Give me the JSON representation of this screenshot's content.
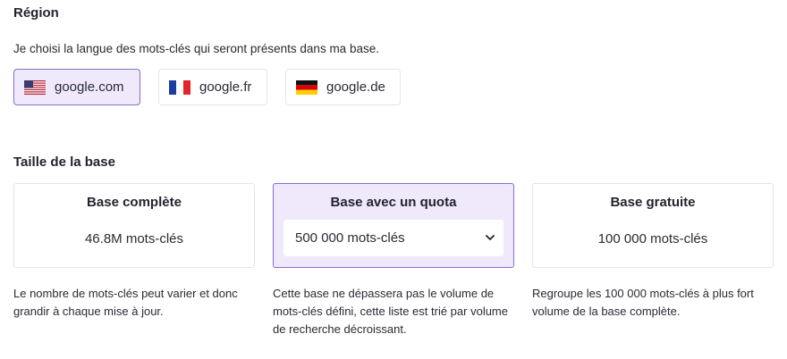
{
  "region": {
    "title": "Région",
    "description": "Je choisi la langue des mots-clés qui seront présents dans ma base.",
    "options": [
      {
        "label": "google.com",
        "flag": "us-flag-icon",
        "selected": true
      },
      {
        "label": "google.fr",
        "flag": "fr-flag-icon",
        "selected": false
      },
      {
        "label": "google.de",
        "flag": "de-flag-icon",
        "selected": false
      }
    ]
  },
  "base_size": {
    "title": "Taille de la base",
    "cards": [
      {
        "title": "Base complète",
        "value": "46.8M mots-clés",
        "description": "Le nombre de mots-clés peut varier et donc grandir à chaque mise à jour.",
        "selected": false
      },
      {
        "title": "Base avec un quota",
        "select_value": "500 000 mots-clés",
        "description": "Cette base ne dépassera pas le volume de mots-clés défini, cette liste est trié par volume de recherche décroissant.",
        "selected": true
      },
      {
        "title": "Base gratuite",
        "value": "100 000 mots-clés",
        "description": "Regroupe les 100 000 mots-clés à plus fort volume de la base complète.",
        "selected": false
      }
    ]
  },
  "colors": {
    "accent_bg": "#efe9fb",
    "accent_border": "#8a6cd0"
  }
}
